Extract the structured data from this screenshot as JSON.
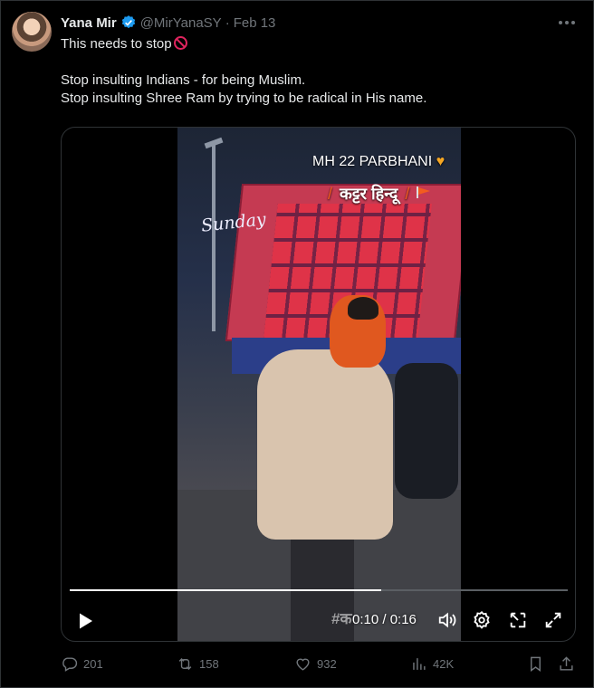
{
  "post": {
    "author_name": "Yana Mir",
    "handle": "@MirYanaSY",
    "separator": "·",
    "date": "Feb 13",
    "text_line1": "This needs to stop",
    "text_line2": "Stop insulting Indians - for being Muslim.",
    "text_line3": "Stop insulting Shree Ram by trying to be radical in His name."
  },
  "video": {
    "overlay_title": "MH 22 PARBHANI",
    "overlay_subtitle": "कट्टर हिन्दू",
    "overlay_script": "Sunday",
    "overlay_bottom": "#क",
    "time_display": "0:10 / 0:16",
    "progress_fraction": 0.625
  },
  "actions": {
    "replies": "201",
    "reposts": "158",
    "likes": "932",
    "views": "42K"
  },
  "icons": [
    "verified-badge-icon",
    "more-icon",
    "no-entry-icon",
    "play-icon",
    "volume-icon",
    "settings-icon",
    "pip-icon",
    "fullscreen-icon",
    "reply-icon",
    "repost-icon",
    "like-icon",
    "views-icon",
    "bookmark-icon",
    "share-icon"
  ],
  "colors": {
    "accent": "#1d9bf0",
    "muted": "#71767b",
    "text": "#e7e9ea",
    "background": "#000000"
  }
}
